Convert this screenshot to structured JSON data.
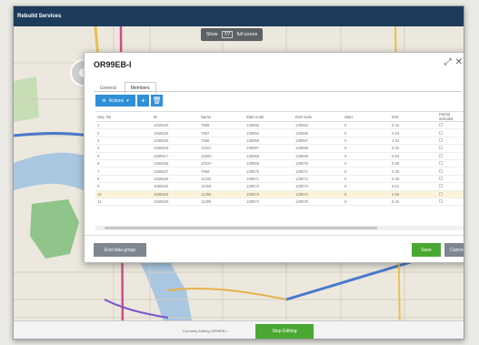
{
  "app": {
    "brand": "Rebuild Services"
  },
  "map_toolbar": {
    "label": "Show",
    "count": "7/7",
    "full": "full screen"
  },
  "dialog": {
    "title": "OR99EB-I",
    "tabs": [
      {
        "label": "General"
      },
      {
        "label": "Members"
      }
    ],
    "actions_label": "Actions",
    "columns": [
      "Seq. No",
      "ID",
      "Name",
      "Start node",
      "End node",
      "Start",
      "End",
      "Partial indicator"
    ],
    "rows": [
      [
        "1",
        "1060524",
        "7966",
        "139066",
        "139064",
        "0",
        "0.42"
      ],
      [
        "2",
        "1060525",
        "7967",
        "139064",
        "139065",
        "0",
        "0.94"
      ],
      [
        "3",
        "1060526",
        "7968",
        "139065",
        "139067",
        "0",
        "1.34"
      ],
      [
        "4",
        "1060619",
        "11201",
        "139067",
        "139068",
        "0",
        "0.32"
      ],
      [
        "5",
        "1060617",
        "13090",
        "139068",
        "139069",
        "0",
        "0.94"
      ],
      [
        "6",
        "1060265",
        "10167",
        "139069",
        "139070",
        "0",
        "0.96"
      ],
      [
        "7",
        "1060537",
        "7969",
        "139070",
        "139071",
        "0",
        "0.35"
      ],
      [
        "8",
        "1060625",
        "11202",
        "139071",
        "139072",
        "0",
        "0.35"
      ],
      [
        "9",
        "1060632",
        "11326",
        "139072",
        "139073",
        "0",
        "0.51"
      ],
      [
        "10",
        "1060618",
        "11390",
        "139073",
        "139074",
        "0",
        "0.56"
      ],
      [
        "11",
        "1060620",
        "11390",
        "139074",
        "139075",
        "0",
        "0.42"
      ]
    ],
    "highlighted_row": 10,
    "buttons": {
      "end": "End data group",
      "save": "Save",
      "cancel": "Cancel"
    }
  },
  "status": {
    "text": "Currently Editing OR99EB-I",
    "stop": "Stop Editing"
  }
}
